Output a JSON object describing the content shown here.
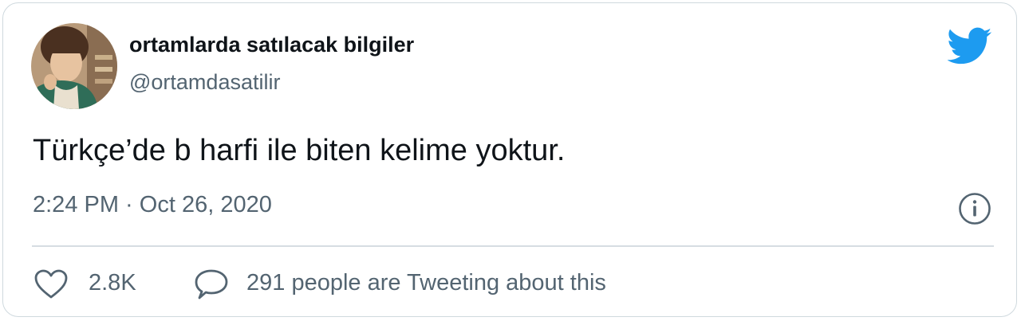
{
  "author": {
    "display_name": "ortamlarda satılacak bilgiler",
    "handle": "@ortamdasatilir",
    "avatar": "profile-photo"
  },
  "tweet": {
    "text": "Türkçe’de b harfi ile biten kelime yoktur.",
    "timestamp": "2:24 PM · Oct 26, 2020"
  },
  "actions": {
    "like_count": "2.8K",
    "reply_text": "291 people are Tweeting about this"
  },
  "icons": {
    "brand": "twitter-bird-icon",
    "info": "info-icon",
    "like": "heart-icon",
    "reply": "speech-bubble-icon"
  },
  "colors": {
    "brand": "#1d9bf0",
    "text_primary": "#0f1419",
    "text_secondary": "#536471",
    "border": "#cfd9de"
  }
}
